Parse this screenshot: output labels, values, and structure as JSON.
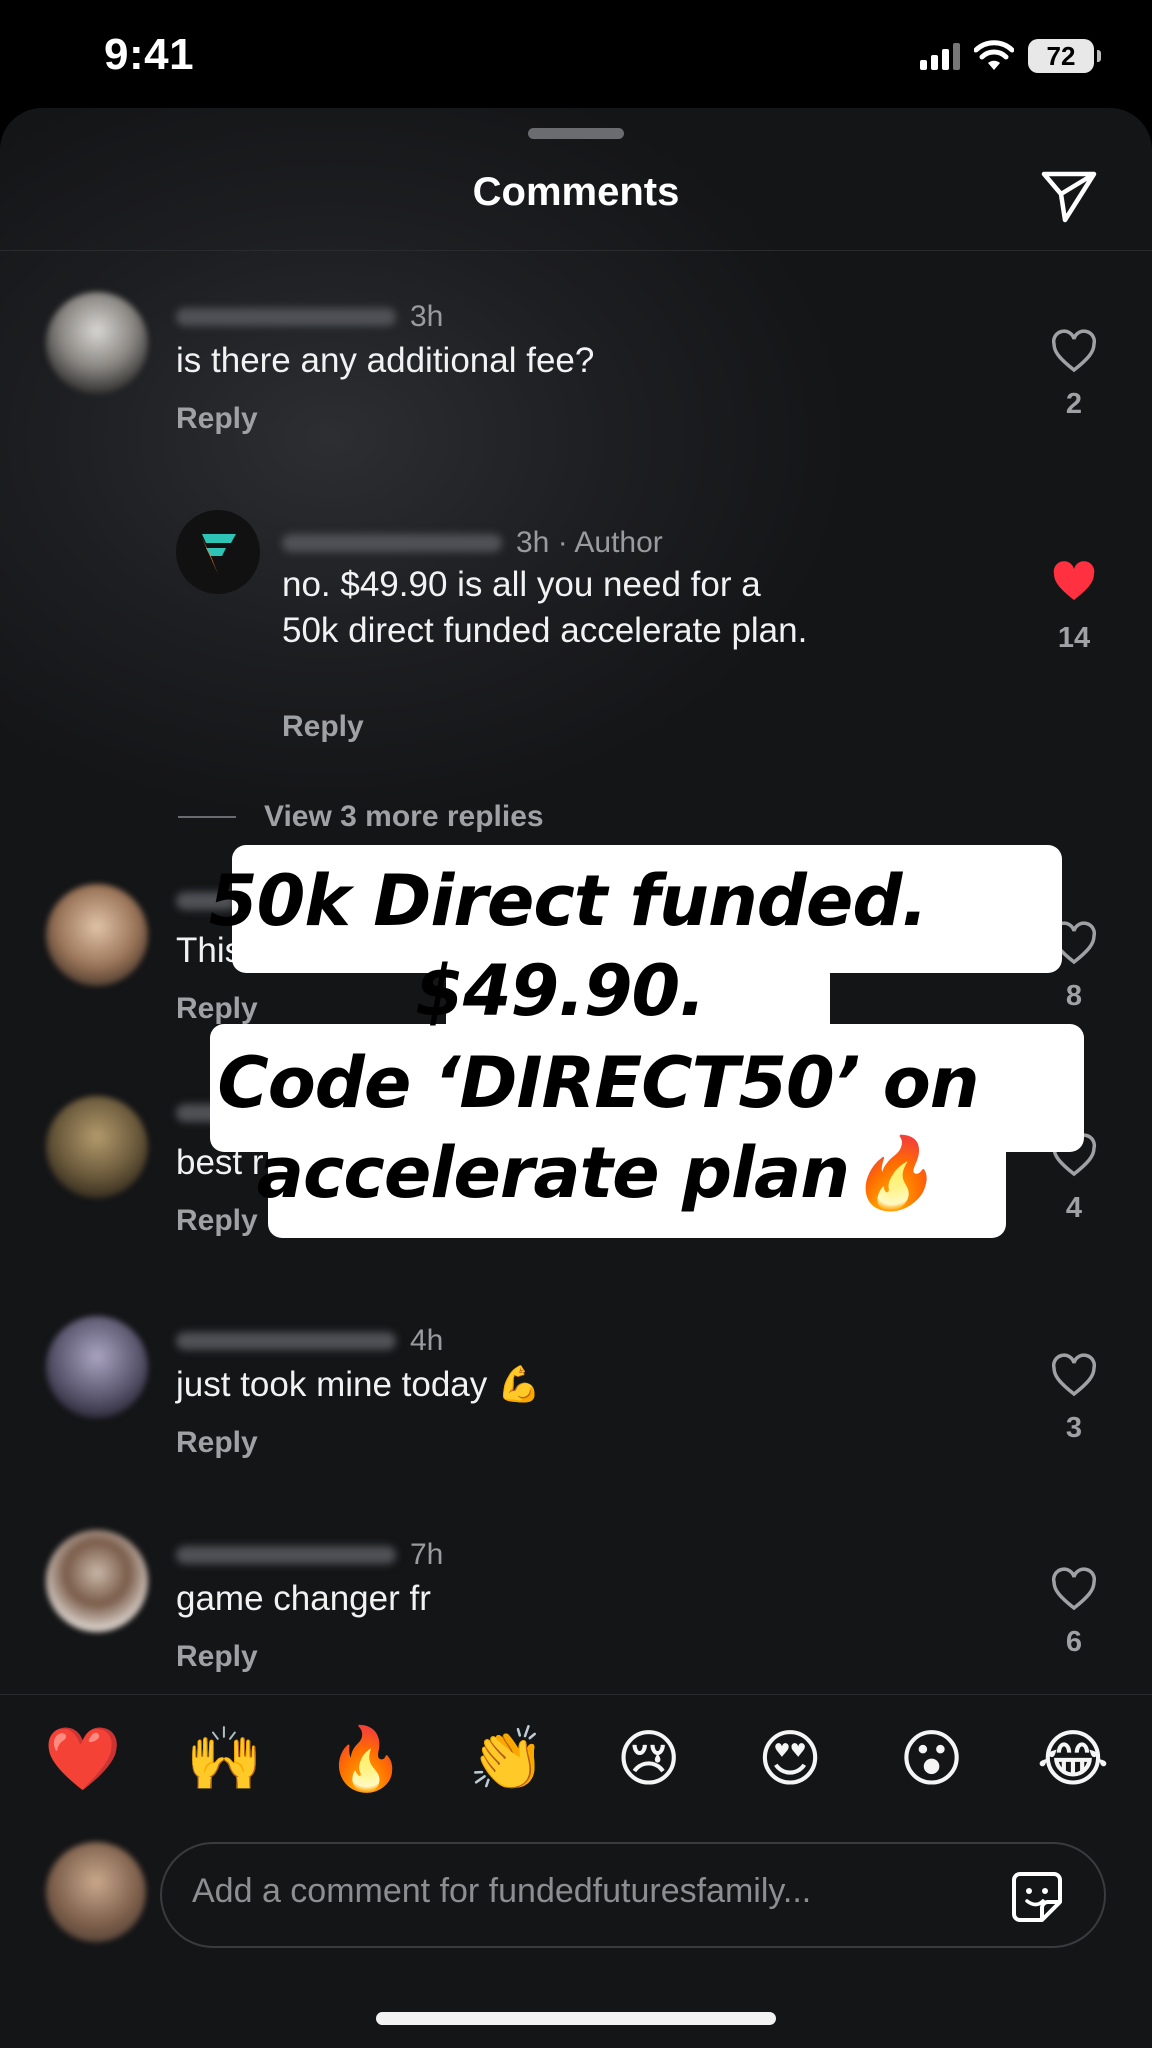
{
  "status_bar": {
    "time": "9:41",
    "battery": "72"
  },
  "sheet": {
    "title": "Comments"
  },
  "comments": [
    {
      "time": "3h",
      "text": "is there any additional fee?",
      "reply": "Reply",
      "likes": "2",
      "liked": false
    },
    {
      "time": "3h · Author",
      "text": "no. $49.90 is all you need for a 50k direct funded accelerate plan.",
      "reply": "Reply",
      "likes": "14",
      "liked": true
    },
    {
      "time": "",
      "text": "This",
      "reply": "Reply",
      "likes": "8",
      "liked": false
    },
    {
      "time": "",
      "text": "best r",
      "reply": "Reply",
      "likes": "4",
      "liked": false
    },
    {
      "time": "4h",
      "text": "just took mine today 💪",
      "reply": "Reply",
      "likes": "3",
      "liked": false
    },
    {
      "time": "7h",
      "text": "game changer fr",
      "reply": "Reply",
      "likes": "6",
      "liked": false
    }
  ],
  "view_more": "View 3 more replies",
  "overlay": {
    "line1": "50k Direct funded.",
    "line2": "$49.90.",
    "line3": "Code ‘DIRECT50’ on",
    "line4": "accelerate plan🔥"
  },
  "emoji_bar": [
    "❤️",
    "🙌",
    "🔥",
    "👏",
    "😢",
    "😍",
    "😮",
    "😂"
  ],
  "composer": {
    "placeholder": "Add a comment for fundedfuturesfamily..."
  },
  "colors": {
    "background": "#1d1e21",
    "like_active": "#ff3040",
    "text_primary": "#f2f2f2",
    "text_secondary": "#9a9b9f"
  }
}
